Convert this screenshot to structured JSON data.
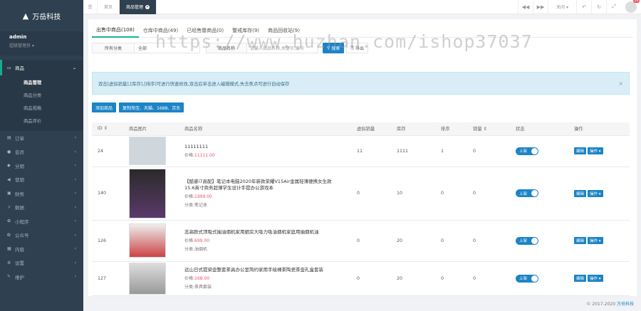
{
  "brand": {
    "name": "万岳科技"
  },
  "user": {
    "name": "admin",
    "role": "超级管理员 ▾"
  },
  "menu": [
    {
      "label": "商品",
      "icon": "monitor-icon",
      "active": true
    },
    {
      "label": "订单"
    },
    {
      "label": "会员"
    },
    {
      "label": "分销"
    },
    {
      "label": "营销"
    },
    {
      "label": "财务"
    },
    {
      "label": "数据"
    },
    {
      "label": "小程序"
    },
    {
      "label": "公众号"
    },
    {
      "label": "内容"
    },
    {
      "label": "设置"
    },
    {
      "label": "维护"
    }
  ],
  "submenu": [
    {
      "label": "商品管理",
      "on": true
    },
    {
      "label": "商品分类"
    },
    {
      "label": "商品规格"
    },
    {
      "label": "商品评价"
    }
  ],
  "topbar": {
    "tab_home": "首页",
    "tab_current": "商品管理",
    "close": "关闭 ▾",
    "badge": "20"
  },
  "tabs": [
    "出售中商品(108)",
    "仓库中商品(49)",
    "已经售罄商品(0)",
    "警戒库存(9)",
    "商品回收站(9)"
  ],
  "filter": {
    "category_label": "所有分类",
    "category_value": "全部",
    "name_label": "商品名称",
    "name_placeholder": "请输入商品名称,关键字,编号",
    "search": "搜索",
    "export": "导出"
  },
  "alert": "双击[虚拟销量],[库存],[排序]可进行快速修改,双击后单击进入编辑模式,失去焦点可进行自动保存",
  "actions": {
    "add": "添加商品",
    "copy": "复制淘宝、天猫、1688、京东"
  },
  "table": {
    "headers": [
      "ID ⇕",
      "商品图片",
      "商品名称",
      "虚拟销量",
      "库存",
      "排序",
      "销量 ⇕",
      "状态",
      "操作"
    ],
    "rows": [
      {
        "id": "24",
        "name": "11111111",
        "price_label": "价格:",
        "price": "11111.00",
        "category": "",
        "virtual_sales": "11",
        "stock": "1111",
        "sort": "1",
        "sales": "0",
        "status": "上架"
      },
      {
        "id": "140",
        "name": "【酷睿i7高配】笔记本电脑2020年新款荣耀V15Air金属轻薄便携女生款15.6英寸商务超薄学生设计手提办公游戏本",
        "price_label": "价格:",
        "price": "1999.00",
        "category": "分类:笔记本",
        "virtual_sales": "0",
        "stock": "10",
        "sort": "0",
        "sales": "0",
        "status": "上架"
      },
      {
        "id": "126",
        "name": "志高欧式顶吸式抽油烟机家用厨房大吸力吸油烟机家庭用抽烟机油",
        "price_label": "价格:",
        "price": "699.00",
        "category": "分类:油烟机",
        "virtual_sales": "0",
        "stock": "20",
        "sort": "0",
        "sales": "0",
        "status": "上架"
      },
      {
        "id": "127",
        "name": "远山日式提梁壶整套茶具办公室简约家用手绘裸茶陶瓷茶壶礼盒套装",
        "price_label": "价格:",
        "price": "168.00",
        "category": "分类:茶具套装",
        "virtual_sales": "0",
        "stock": "20",
        "sort": "0",
        "sales": "0",
        "status": "上架"
      }
    ],
    "op_edit": "编辑",
    "op_more": "操作 ▾"
  },
  "watermark": "https://www.huzhan.com/ishop37037",
  "footer": {
    "copy": "© 2017-2020",
    "brand": "万岳科技"
  }
}
